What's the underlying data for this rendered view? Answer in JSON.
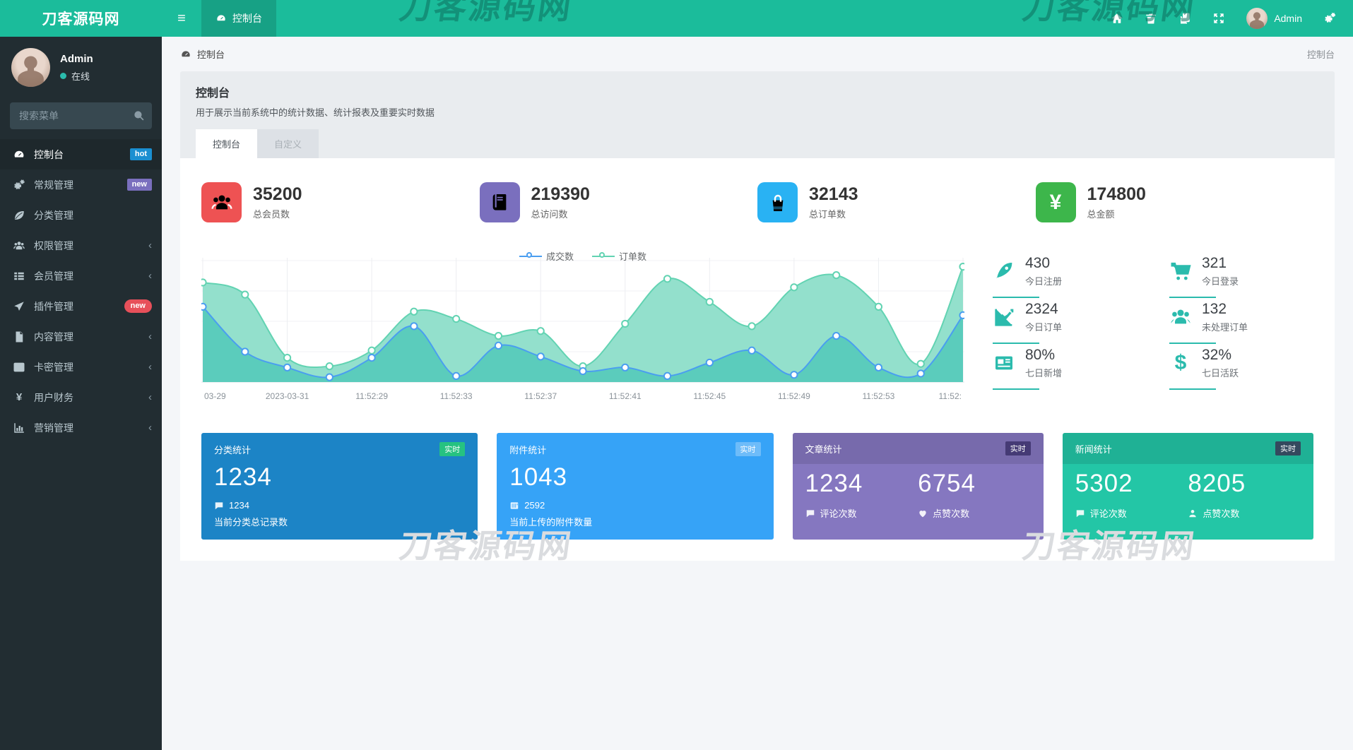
{
  "colors": {
    "navbar": "#1bbc9b",
    "navbar_tab": "#109b81",
    "sidebar": "#222d32",
    "accent": "#2bbbad",
    "panel_gray": "#e9ecef"
  },
  "brand": {
    "title": "刀客源码网"
  },
  "navbar": {
    "active_tab": "控制台",
    "username": "Admin"
  },
  "user_panel": {
    "name": "Admin",
    "status": "在线"
  },
  "search": {
    "placeholder": "搜索菜单"
  },
  "sidebar": {
    "items": [
      {
        "label": "控制台",
        "icon": "dashboard-icon",
        "badge": "hot",
        "badge_color": "#1a8fd1",
        "active": true
      },
      {
        "label": "常规管理",
        "icon": "cogs-icon",
        "badge": "new",
        "badge_color": "#7a6fbe"
      },
      {
        "label": "分类管理",
        "icon": "leaf-icon"
      },
      {
        "label": "权限管理",
        "icon": "users-icon",
        "chevron": "‹"
      },
      {
        "label": "会员管理",
        "icon": "list-icon",
        "chevron": "‹"
      },
      {
        "label": "插件管理",
        "icon": "rocket-icon",
        "badge": "new",
        "badge_color": "#e7505a",
        "badge_pill": true
      },
      {
        "label": "内容管理",
        "icon": "file-icon",
        "chevron": "‹"
      },
      {
        "label": "卡密管理",
        "icon": "image-icon",
        "chevron": "‹"
      },
      {
        "label": "用户财务",
        "icon": "yen-icon",
        "chevron": "‹"
      },
      {
        "label": "营销管理",
        "icon": "bar-chart-icon",
        "chevron": "‹"
      }
    ]
  },
  "breadcrumb": {
    "left": "控制台",
    "right": "控制台"
  },
  "page_header": {
    "title": "控制台",
    "subtitle": "用于展示当前系统中的统计数据、统计报表及重要实时数据",
    "tabs": [
      {
        "label": "控制台"
      },
      {
        "label": "自定义"
      }
    ]
  },
  "stats": [
    {
      "value": "35200",
      "label": "总会员数",
      "color": "#ee5253",
      "icon": "users-group-icon"
    },
    {
      "value": "219390",
      "label": "总访问数",
      "color": "#7a6fbe",
      "icon": "book-icon"
    },
    {
      "value": "32143",
      "label": "总订单数",
      "color": "#29b2f3",
      "icon": "shopping-bag-icon"
    },
    {
      "value": "174800",
      "label": "总金额",
      "color": "#3db64b",
      "icon": "yen-icon"
    }
  ],
  "chart_data": {
    "type": "area",
    "x_labels": [
      "03-29",
      "2023-03-31",
      "11:52:29",
      "11:52:33",
      "11:52:37",
      "11:52:41",
      "11:52:45",
      "11:52:49",
      "11:52:53",
      "11:52:"
    ],
    "label_point_indices": [
      0,
      2,
      4,
      6,
      8,
      10,
      12,
      14,
      16,
      18
    ],
    "ylim": [
      0,
      100
    ],
    "grid": true,
    "legend_position": "top-center",
    "series": [
      {
        "name": "成交数",
        "color": "#4a9ef0",
        "fill": "#58cbbb",
        "values": [
          62,
          25,
          12,
          4,
          20,
          46,
          5,
          30,
          21,
          9,
          12,
          5,
          16,
          26,
          6,
          38,
          12,
          7,
          55
        ]
      },
      {
        "name": "订单数",
        "color": "#62d3b2",
        "fill": "#8fdfca",
        "values": [
          82,
          72,
          20,
          13,
          26,
          58,
          52,
          38,
          42,
          13,
          48,
          85,
          66,
          46,
          78,
          88,
          62,
          15,
          95
        ]
      }
    ]
  },
  "mini_stats": [
    {
      "value": "430",
      "label": "今日注册",
      "icon": "rocket-icon"
    },
    {
      "value": "321",
      "label": "今日登录",
      "icon": "cart-icon"
    },
    {
      "value": "2324",
      "label": "今日订单",
      "icon": "line-chart-icon"
    },
    {
      "value": "132",
      "label": "未处理订单",
      "icon": "users-group-icon"
    },
    {
      "value": "80%",
      "label": "七日新增",
      "icon": "newspaper-icon"
    },
    {
      "value": "32%",
      "label": "七日活跃",
      "icon": "dollar-icon"
    }
  ],
  "cards": [
    {
      "title": "分类统计",
      "badge": "实时",
      "badge_color": "#26c281",
      "color": "#1c84c6",
      "value": "1234",
      "sub_value": "1234",
      "sub_icon": "comment-icon",
      "sub_label": "当前分类总记录数"
    },
    {
      "title": "附件统计",
      "badge": "实时",
      "badge_color": "rgba(255,255,255,.28)",
      "color": "#36a3f7",
      "value": "1043",
      "sub_value": "2592",
      "sub_icon": "tally-icon",
      "sub_label": "当前上传的附件数量"
    },
    {
      "title": "文章统计",
      "badge": "实时",
      "badge_color": "#453a75",
      "color": "#8577c0",
      "metrics": [
        {
          "value": "1234",
          "label": "评论次数",
          "icon": "comment-icon"
        },
        {
          "value": "6754",
          "label": "点赞次数",
          "icon": "heart-icon"
        }
      ]
    },
    {
      "title": "新闻统计",
      "badge": "实时",
      "badge_color": "#34495e",
      "color": "#23c6a6",
      "metrics": [
        {
          "value": "5302",
          "label": "评论次数",
          "icon": "comment-icon"
        },
        {
          "value": "8205",
          "label": "点赞次数",
          "icon": "user-icon"
        }
      ]
    }
  ],
  "watermark": {
    "text": "刀客源码网"
  }
}
